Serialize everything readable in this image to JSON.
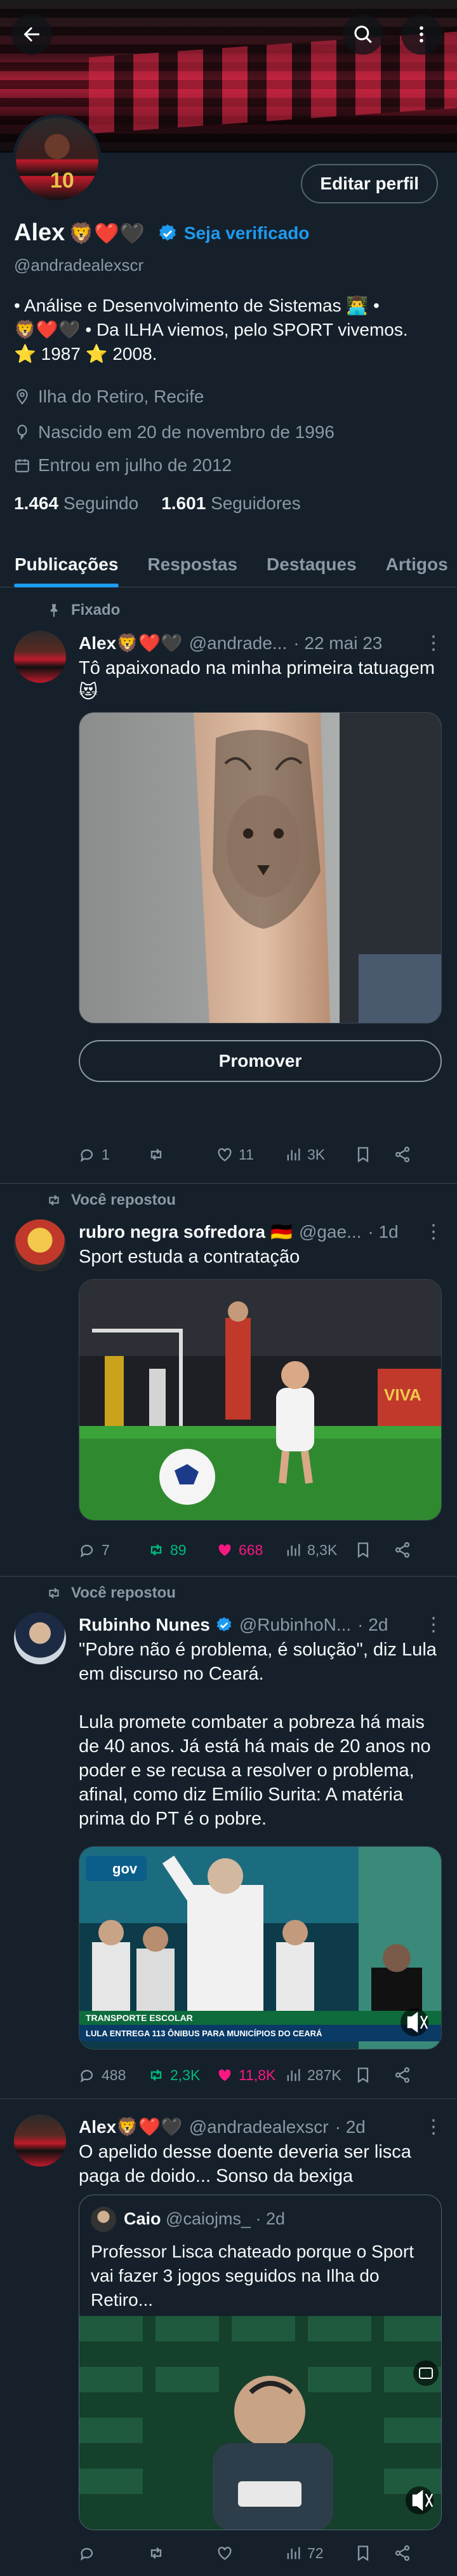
{
  "header": {
    "back_icon": "arrow-left-icon",
    "search_icon": "search-icon",
    "more_icon": "more-vertical-icon"
  },
  "profile": {
    "name": "Alex",
    "name_emojis": "🦁❤️🖤",
    "verify_label": "Seja verificado",
    "handle": "@andradealexscr",
    "edit_label": "Editar perfil",
    "bio_lines": [
      "• Análise e Desenvolvimento de Sistemas 👨‍💻 •",
      "🦁❤️🖤 • Da ILHA viemos, pelo SPORT vivemos.",
      "⭐ 1987 ⭐ 2008."
    ],
    "location": "Ilha do Retiro, Recife",
    "birth": "Nascido em 20 de novembro de 1996",
    "joined": "Entrou em julho de 2012",
    "following_count": "1.464",
    "following_label": "Seguindo",
    "followers_count": "1.601",
    "followers_label": "Seguidores",
    "avatar_number": "10"
  },
  "tabs": [
    "Publicações",
    "Respostas",
    "Destaques",
    "Artigos"
  ],
  "tweets": [
    {
      "context": "Fixado",
      "name": "Alex",
      "name_emojis": "🦁❤️🖤",
      "handle": "@andrade...",
      "time": "· 22 mai 23",
      "text": "Tô apaixonado na minha primeira tatuagem 😻",
      "promote_label": "Promover",
      "replies": "1",
      "retweets": "",
      "likes": "11",
      "views": "3K"
    },
    {
      "context": "Você repostou",
      "name": "rubro negra sofredora",
      "name_emojis": "🇩🇪",
      "handle": "@gae...",
      "time": "· 1d",
      "text": "Sport estuda a contratação",
      "replies": "7",
      "retweets": "89",
      "likes": "668",
      "views": "8,3K",
      "banner_text": "VIVA"
    },
    {
      "context": "Você repostou",
      "name": "Rubinho Nunes",
      "name_emojis": "",
      "handle": "@RubinhoN...",
      "time": "· 2d",
      "text": "\"Pobre não é problema, é solução\", diz Lula em discurso no Ceará.\n\nLula promete combater a pobreza há mais de 40 anos. Já está há mais de 20 anos no poder e se recusa a resolver o problema, afinal, como diz Emílio Surita: A matéria prima do PT é o pobre.",
      "replies": "488",
      "retweets": "2,3K",
      "likes": "11,8K",
      "views": "287K",
      "media_tag": "TRANSPORTE ESCOLAR",
      "media_caption": "LULA ENTREGA 113 ÔNIBUS PARA MUNICÍPIOS DO CEARÁ",
      "media_logo": "gov"
    },
    {
      "context": "",
      "name": "Alex",
      "name_emojis": "🦁❤️🖤",
      "handle": "@andradealexscr",
      "time": "· 2d",
      "text": "O apelido desse doente deveria ser lisca paga de doido... Sonso da bexiga",
      "quote": {
        "name": "Caio",
        "handle": "@caiojms_",
        "time": "· 2d",
        "text": "Professor Lisca chateado porque o Sport vai fazer 3 jogos seguidos na Ilha do Retiro..."
      },
      "replies": "",
      "retweets": "",
      "likes": "",
      "views": "72"
    }
  ],
  "colors": {
    "background": "#15202b",
    "accent": "#1d9bf0",
    "retweet": "#00ba7c",
    "like": "#f91880",
    "muted": "#8b98a5"
  }
}
